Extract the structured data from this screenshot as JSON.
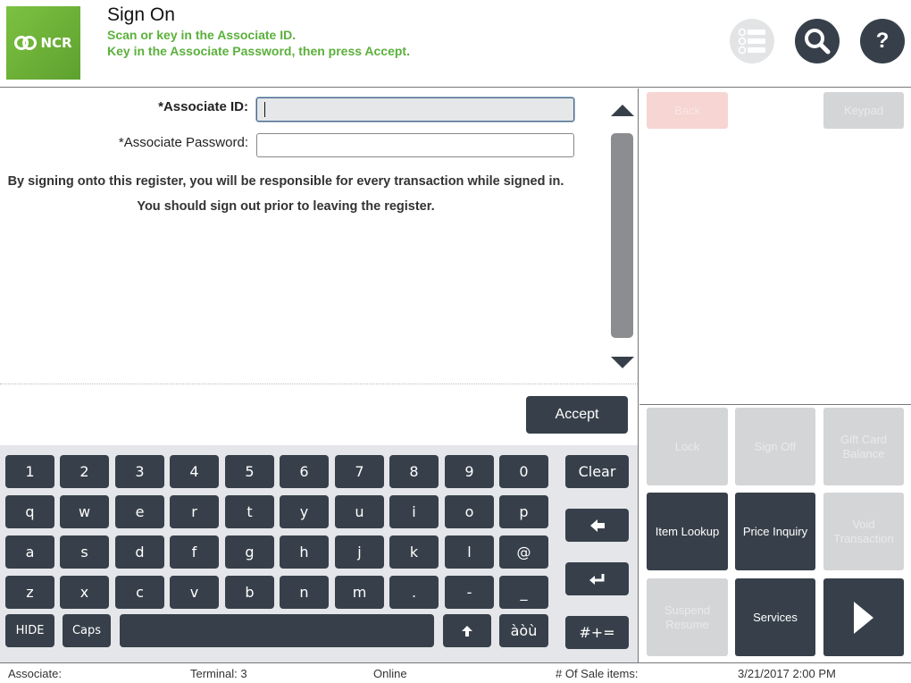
{
  "header": {
    "logo_text": "NCR",
    "title": "Sign On",
    "subtitle_line1": "Scan or key in the Associate ID.",
    "subtitle_line2": "Key in the Associate Password, then press Accept.",
    "list_icon": "numbered-list-icon",
    "search_icon": "search-icon",
    "help_label": "?"
  },
  "form": {
    "associate_id_label": "*Associate ID:",
    "associate_id_value": "",
    "associate_password_label": "*Associate Password:",
    "associate_password_value": "",
    "notice_line1": "By signing onto this register, you will be responsible for every transaction while signed in.",
    "notice_line2": "You should sign out prior to leaving the register.",
    "accept_label": "Accept"
  },
  "right_panel": {
    "back_label": "Back",
    "keypad_label": "Keypad",
    "lock_label": "Lock",
    "sign_off_label": "Sign Off",
    "gift_card_label": "Gift Card Balance",
    "item_lookup_label": "Item Lookup",
    "price_inquiry_label": "Price Inquiry",
    "void_transaction_label": "Void Transaction",
    "suspend_resume_label": "Suspend Resume",
    "services_label": "Services",
    "next_icon": "play-arrow-icon"
  },
  "keyboard": {
    "row1": [
      "1",
      "2",
      "3",
      "4",
      "5",
      "6",
      "7",
      "8",
      "9",
      "0"
    ],
    "row2": [
      "q",
      "w",
      "e",
      "r",
      "t",
      "y",
      "u",
      "i",
      "o",
      "p"
    ],
    "row3": [
      "a",
      "s",
      "d",
      "f",
      "g",
      "h",
      "j",
      "k",
      "l",
      "@"
    ],
    "row4": [
      "z",
      "x",
      "c",
      "v",
      "b",
      "n",
      "m",
      ".",
      "-",
      "_"
    ],
    "hide_label": "HIDE",
    "caps_label": "Caps",
    "accent_label": "àòù",
    "clear_label": "Clear",
    "symbols_label": "#+=",
    "shift_icon": "up-arrow-icon",
    "backspace_icon": "left-arrow-icon",
    "enter_icon": "enter-icon"
  },
  "status_bar": {
    "associate": "Associate:",
    "terminal": "Terminal: 3",
    "online": "Online",
    "sale_items": "# Of Sale items:",
    "datetime": "3/21/2017 2:00 PM"
  },
  "colors": {
    "brand_green": "#5cb03c",
    "button_dark": "#37404a",
    "disabled_gray": "#d3d5d7",
    "back_disabled": "#f6d5d3"
  }
}
